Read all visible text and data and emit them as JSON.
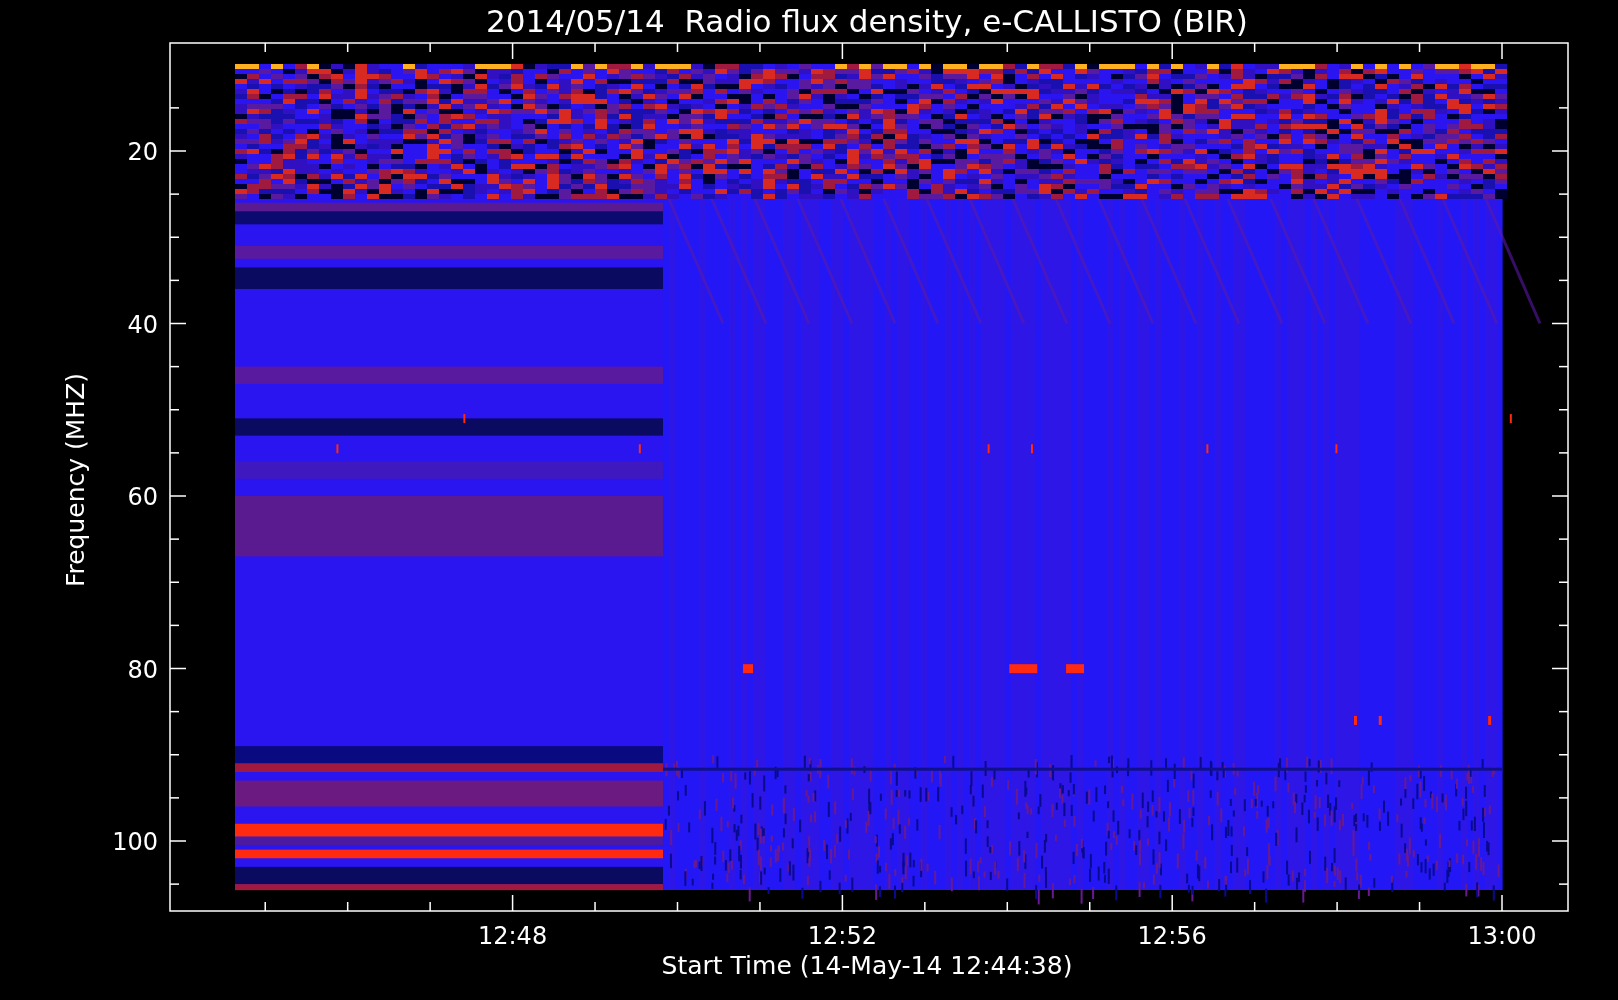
{
  "title": "2014/05/14  Radio flux density, e-CALLISTO (BIR)",
  "y_axis": {
    "label": "Frequency (MHZ)",
    "ticks": [
      "20",
      "40",
      "60",
      "80",
      "100"
    ]
  },
  "x_axis": {
    "label": "Start Time (14-May-14 12:44:38)",
    "ticks": [
      "12:48",
      "12:52",
      "12:56",
      "13:00"
    ]
  }
}
